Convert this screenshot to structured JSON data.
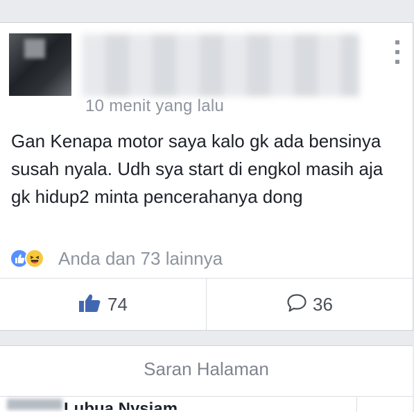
{
  "post": {
    "time": "10 menit yang lalu",
    "text": "Gan Kenapa motor saya kalo gk ada bensinya susah nyala. Udh sya start di engkol masih aja gk hidup2 minta pencerahanya dong",
    "reactions_text": "Anda dan 73 lainnya",
    "reaction_icons": [
      "like-reaction-icon",
      "haha-reaction-icon"
    ],
    "like_count": "74",
    "comment_count": "36"
  },
  "suggestions": {
    "title": "Saran Halaman",
    "next_page_name": "Lubua Nysiam"
  },
  "colors": {
    "accent": "#4267b2",
    "like_blue": "#5890ff",
    "haha_yellow": "#f7c83b",
    "muted_text": "#8d949e",
    "background": "#e9ebee"
  }
}
